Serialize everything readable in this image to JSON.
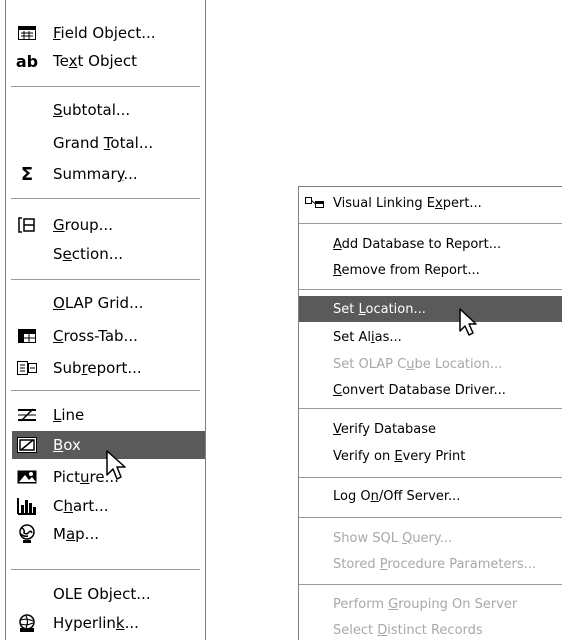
{
  "left_menu": {
    "items": [
      {
        "pre": "",
        "acc": "F",
        "post": "ield Object...",
        "icon": "field-object-icon"
      },
      {
        "pre": "Te",
        "acc": "x",
        "post": "t Object",
        "icon": "text-object-icon"
      },
      {
        "pre": "",
        "acc": "S",
        "post": "ubtotal...",
        "icon": ""
      },
      {
        "pre": "Grand ",
        "acc": "T",
        "post": "otal...",
        "icon": ""
      },
      {
        "pre": "Summar",
        "acc": "y",
        "post": "...",
        "icon": "summary-sigma-icon"
      },
      {
        "pre": "",
        "acc": "G",
        "post": "roup...",
        "icon": "group-icon"
      },
      {
        "pre": "S",
        "acc": "e",
        "post": "ction...",
        "icon": ""
      },
      {
        "pre": "",
        "acc": "O",
        "post": "LAP Grid...",
        "icon": ""
      },
      {
        "pre": "",
        "acc": "C",
        "post": "ross-Tab...",
        "icon": "cross-tab-icon"
      },
      {
        "pre": "Sub",
        "acc": "r",
        "post": "eport...",
        "icon": "subreport-icon"
      },
      {
        "pre": "",
        "acc": "L",
        "post": "ine",
        "icon": "line-icon"
      },
      {
        "pre": "",
        "acc": "B",
        "post": "ox",
        "icon": "box-icon"
      },
      {
        "pre": "Pict",
        "acc": "u",
        "post": "re...",
        "icon": "picture-icon"
      },
      {
        "pre": "C",
        "acc": "h",
        "post": "art...",
        "icon": "chart-icon"
      },
      {
        "pre": "M",
        "acc": "a",
        "post": "p...",
        "icon": "map-icon"
      },
      {
        "pre": "OLE Ob",
        "acc": "j",
        "post": "ect...",
        "icon": ""
      },
      {
        "pre": "Hyperlin",
        "acc": "k",
        "post": "...",
        "icon": "hyperlink-icon"
      }
    ],
    "selected": "Box",
    "text_icon_glyph": "ab",
    "sigma_glyph": "Σ"
  },
  "right_menu": {
    "items": [
      {
        "pre": "Visual Linking E",
        "acc": "x",
        "post": "pert...",
        "icon": "visual-linking-icon"
      },
      {
        "pre": "",
        "acc": "A",
        "post": "dd Database to Report...",
        "icon": ""
      },
      {
        "pre": "",
        "acc": "R",
        "post": "emove from Report...",
        "icon": ""
      },
      {
        "pre": "Set ",
        "acc": "L",
        "post": "ocation...",
        "icon": ""
      },
      {
        "pre": "Set Al",
        "acc": "i",
        "post": "as...",
        "icon": ""
      },
      {
        "pre": "Set OLAP C",
        "acc": "u",
        "post": "be Location...",
        "icon": ""
      },
      {
        "pre": "",
        "acc": "C",
        "post": "onvert Database Driver...",
        "icon": ""
      },
      {
        "pre": "",
        "acc": "V",
        "post": "erify Database",
        "icon": ""
      },
      {
        "pre": "Verify on ",
        "acc": "E",
        "post": "very Print",
        "icon": ""
      },
      {
        "pre": "Log O",
        "acc": "n",
        "post": "/Off Server...",
        "icon": ""
      },
      {
        "pre": "Show SQL ",
        "acc": "Q",
        "post": "uery...",
        "icon": ""
      },
      {
        "pre": "Stored ",
        "acc": "P",
        "post": "rocedure Parameters...",
        "icon": ""
      },
      {
        "pre": "Perform ",
        "acc": "G",
        "post": "rouping On Server",
        "icon": ""
      },
      {
        "pre": "Select ",
        "acc": "D",
        "post": "istinct Records",
        "icon": ""
      }
    ],
    "selected": "Set Location...",
    "disabled": [
      "Set OLAP Cube Location...",
      "Show SQL Query...",
      "Stored Procedure Parameters...",
      "Perform Grouping On Server",
      "Select Distinct Records"
    ]
  }
}
